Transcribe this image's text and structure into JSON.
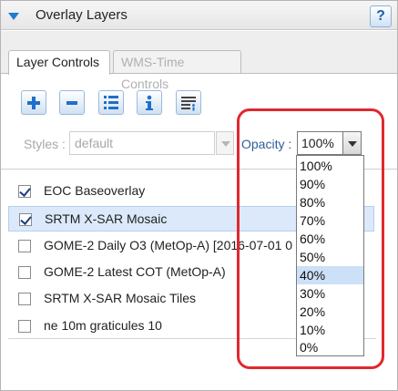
{
  "panel": {
    "title": "Overlay Layers",
    "help_label": "?"
  },
  "tabs": [
    {
      "label": "Layer Controls",
      "active": true
    },
    {
      "label": "WMS-Time Controls",
      "active": false
    }
  ],
  "toolbar": {
    "buttons": [
      {
        "icon": "plus-icon"
      },
      {
        "icon": "minus-icon"
      },
      {
        "icon": "list-icon"
      },
      {
        "icon": "info-icon"
      },
      {
        "icon": "legend-icon"
      }
    ]
  },
  "styles": {
    "label": "Styles :",
    "value": "default"
  },
  "opacity": {
    "label": "Opacity :",
    "value": "100%",
    "options": [
      "100%",
      "90%",
      "80%",
      "70%",
      "60%",
      "50%",
      "40%",
      "30%",
      "20%",
      "10%",
      "0%"
    ],
    "highlighted": "40%"
  },
  "layers": [
    {
      "name": "EOC Baseoverlay",
      "checked": true,
      "selected": false
    },
    {
      "name": "SRTM X-SAR Mosaic",
      "checked": true,
      "selected": true
    },
    {
      "name": "GOME-2 Daily O3 (MetOp-A) [2016-07-01 0",
      "checked": false,
      "selected": false
    },
    {
      "name": "GOME-2 Latest COT (MetOp-A)",
      "checked": false,
      "selected": false
    },
    {
      "name": "SRTM X-SAR Mosaic Tiles",
      "checked": false,
      "selected": false
    },
    {
      "name": "ne 10m graticules 10",
      "checked": false,
      "selected": false
    }
  ],
  "colors": {
    "accent": "#1f7bd1",
    "annotation": "#e0282f",
    "selection": "#dbe9fa"
  }
}
